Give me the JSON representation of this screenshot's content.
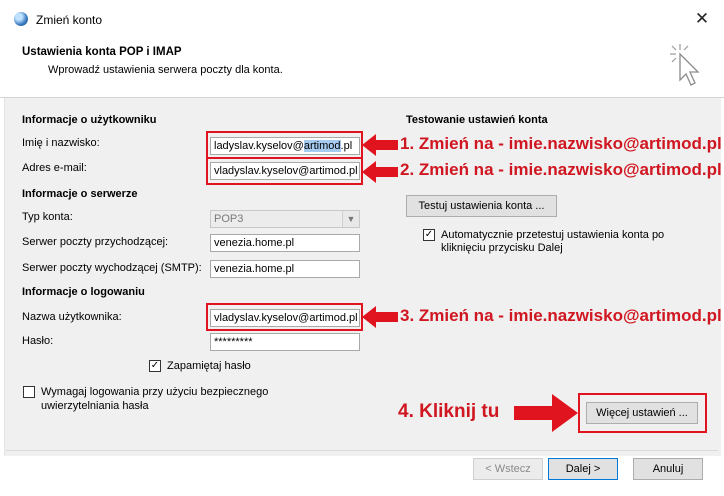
{
  "window": {
    "title": "Zmień konto",
    "header_title": "Ustawienia konta POP i IMAP",
    "header_subtitle": "Wprowadź ustawienia serwera poczty dla konta."
  },
  "user_info": {
    "section": "Informacje o użytkowniku",
    "name_label": "Imię i nazwisko:",
    "name_value_pre": "ladyslav.kyselov@",
    "name_value_sel": "artimod",
    "name_value_post": ".pl",
    "email_label": "Adres e-mail:",
    "email_value": "vladyslav.kyselov@artimod.pl"
  },
  "server_info": {
    "section": "Informacje o serwerze",
    "account_type_label": "Typ konta:",
    "account_type_value": "POP3",
    "incoming_label": "Serwer poczty przychodzącej:",
    "incoming_value": "venezia.home.pl",
    "outgoing_label": "Serwer poczty wychodzącej (SMTP):",
    "outgoing_value": "venezia.home.pl"
  },
  "login_info": {
    "section": "Informacje o logowaniu",
    "username_label": "Nazwa użytkownika:",
    "username_value": "vladyslav.kyselov@artimod.pl",
    "password_label": "Hasło:",
    "password_value": "*********",
    "remember_label": "Zapamiętaj hasło",
    "remember_checked": true,
    "spa_label_line1": "Wymagaj logowania przy użyciu bezpiecznego",
    "spa_label_line2": "uwierzytelniania hasła",
    "spa_checked": false
  },
  "test": {
    "section": "Testowanie ustawień konta",
    "test_button": "Testuj ustawienia konta ...",
    "auto_test_line1": "Automatycznie przetestuj ustawienia konta po",
    "auto_test_line2": "kliknięciu przycisku Dalej",
    "auto_test_checked": true
  },
  "buttons": {
    "more_settings": "Więcej ustawień ...",
    "back": "< Wstecz",
    "next": "Dalej >",
    "cancel": "Anuluj"
  },
  "annotations": {
    "step1": "1. Zmień na - imie.nazwisko@artimod.pl",
    "step2": "2. Zmień na - imie.nazwisko@artimod.pl",
    "step3": "3. Zmień na - imie.nazwisko@artimod.pl",
    "step4": "4. Kliknij tu",
    "color": "#e0141e"
  },
  "icons": {
    "app": "outlook-icon",
    "header": "pointer-click-icon",
    "close": "close-icon",
    "check": "✓"
  }
}
